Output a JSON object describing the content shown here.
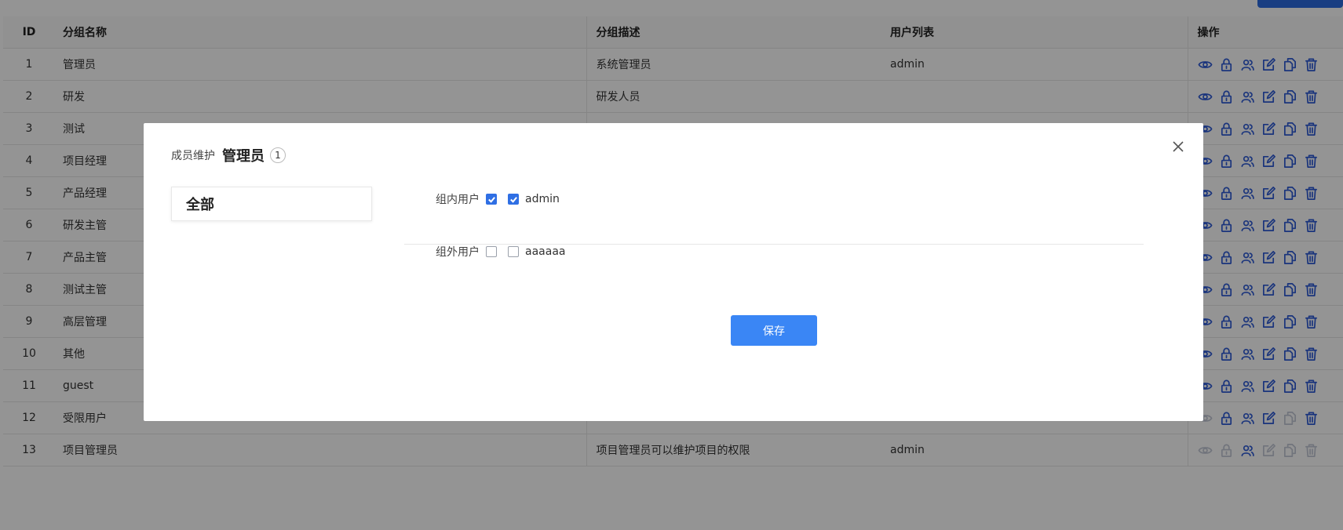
{
  "table": {
    "headers": {
      "id": "ID",
      "name": "分组名称",
      "desc": "分组描述",
      "users": "用户列表",
      "actions": "操作"
    },
    "rows": [
      {
        "id": "1",
        "name": "管理员",
        "desc": "系统管理员",
        "users": "admin",
        "dim": false
      },
      {
        "id": "2",
        "name": "研发",
        "desc": "研发人员",
        "users": "",
        "dim": false
      },
      {
        "id": "3",
        "name": "测试",
        "desc": "",
        "users": "",
        "dim": false
      },
      {
        "id": "4",
        "name": "项目经理",
        "desc": "",
        "users": "",
        "dim": false
      },
      {
        "id": "5",
        "name": "产品经理",
        "desc": "",
        "users": "",
        "dim": false
      },
      {
        "id": "6",
        "name": "研发主管",
        "desc": "",
        "users": "",
        "dim": false
      },
      {
        "id": "7",
        "name": "产品主管",
        "desc": "",
        "users": "",
        "dim": false
      },
      {
        "id": "8",
        "name": "测试主管",
        "desc": "",
        "users": "",
        "dim": false
      },
      {
        "id": "9",
        "name": "高层管理",
        "desc": "",
        "users": "",
        "dim": false
      },
      {
        "id": "10",
        "name": "其他",
        "desc": "",
        "users": "",
        "dim": false
      },
      {
        "id": "11",
        "name": "guest",
        "desc": "",
        "users": "",
        "dim": false
      },
      {
        "id": "12",
        "name": "受限用户",
        "desc": "",
        "users": "",
        "dim": "partial12"
      },
      {
        "id": "13",
        "name": "项目管理员",
        "desc": "项目管理员可以维护项目的权限",
        "users": "admin",
        "dim": "partial13"
      }
    ],
    "action_icons": [
      "eye-icon",
      "lock-icon",
      "users-icon",
      "edit-icon",
      "copy-icon",
      "trash-icon"
    ]
  },
  "modal": {
    "label": "成员维护",
    "group": "管理员",
    "count": "1",
    "side_item": "全部",
    "inside_label": "组内用户",
    "inside_user": "admin",
    "outside_label": "组外用户",
    "outside_user": "aaaaaa",
    "save_label": "保存"
  },
  "colors": {
    "primary": "#3a86f5",
    "icon": "#2d5bd6",
    "icon_disabled": "#c3c9d6",
    "overlay": "rgba(0,0,0,0.42)"
  }
}
